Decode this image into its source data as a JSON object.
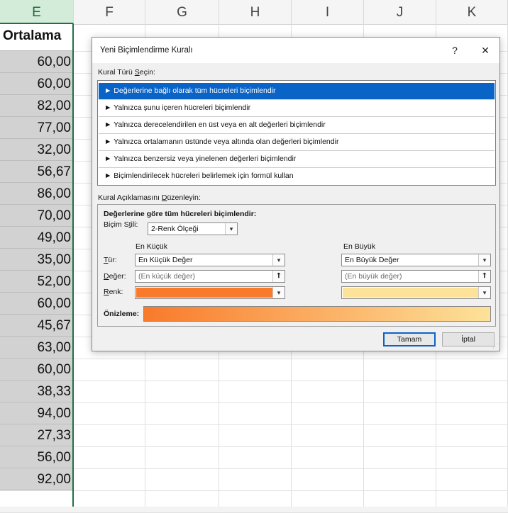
{
  "sheet": {
    "columns": [
      "E",
      "F",
      "G",
      "H",
      "I",
      "J",
      "K"
    ],
    "selected_column": "E",
    "e_header": "Ortalama",
    "e_values": [
      "60,00",
      "60,00",
      "82,00",
      "77,00",
      "32,00",
      "56,67",
      "86,00",
      "70,00",
      "49,00",
      "35,00",
      "52,00",
      "60,00",
      "45,67",
      "63,00",
      "60,00",
      "38,33",
      "94,00",
      "27,33",
      "56,00",
      "92,00"
    ]
  },
  "dialog": {
    "title": "Yeni Biçimlendirme Kuralı",
    "help_label": "?",
    "close_label": "✕",
    "rule_type_label_pre": "Kural Türü ",
    "rule_type_label_u": "S",
    "rule_type_label_post": "eçin:",
    "rule_types": [
      "► Değerlerine bağlı olarak tüm hücreleri biçimlendir",
      "► Yalnızca şunu içeren hücreleri biçimlendir",
      "► Yalnızca derecelendirilen en üst veya en alt değerleri biçimlendir",
      "► Yalnızca ortalamanın üstünde veya altında olan değerleri biçimlendir",
      "► Yalnızca benzersiz veya yinelenen değerleri biçimlendir",
      "► Biçimlendirilecek hücreleri belirlemek için formül kullan"
    ],
    "selected_rule_index": 0,
    "edit_label_pre": "Kural Açıklamasını ",
    "edit_label_u": "D",
    "edit_label_post": "üzenleyin:",
    "desc_heading": "Değerlerine göre tüm hücreleri biçimlendir:",
    "format_style_label_pre": "Biçim S",
    "format_style_label_u": "t",
    "format_style_label_post": "ili:",
    "format_style_value": "2-Renk Ölçeği",
    "min_header": "En Küçük",
    "max_header": "En Büyük",
    "type_label_u": "T",
    "type_label_post": "ür:",
    "value_label_u": "D",
    "value_label_post": "eğer:",
    "color_label_u": "R",
    "color_label_post": "enk:",
    "min_type": "En Küçük Değer",
    "max_type": "En Büyük Değer",
    "min_value_placeholder": "(En küçük değer)",
    "max_value_placeholder": "(En büyük değer)",
    "min_color": "#f97a2b",
    "max_color": "#fde29a",
    "preview_label": "Önizleme:",
    "ok_label": "Tamam",
    "cancel_label": "İptal"
  }
}
